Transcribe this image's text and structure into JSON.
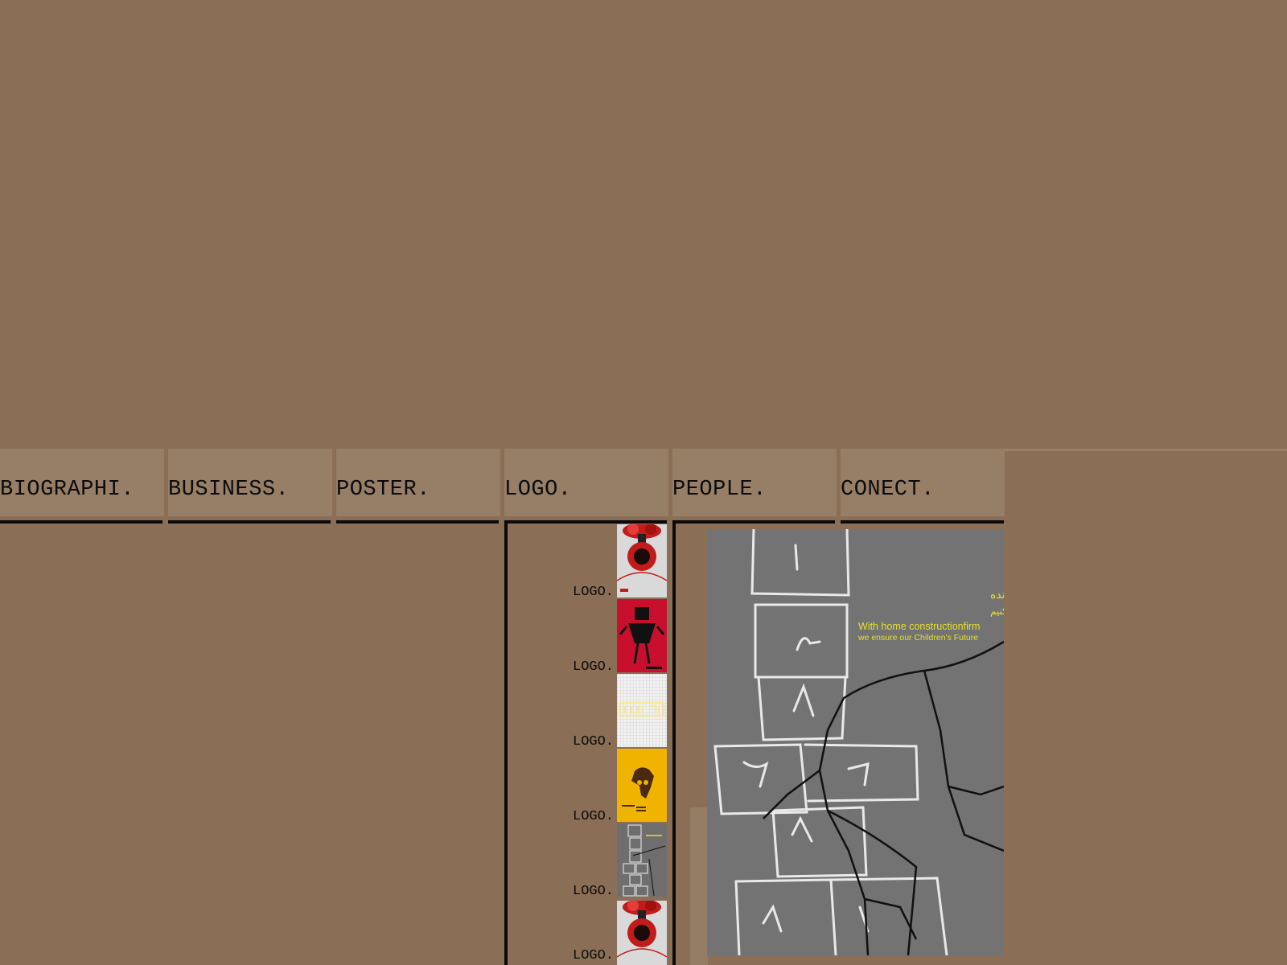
{
  "nav": {
    "tabs": [
      {
        "label": "BIOGRAPHI."
      },
      {
        "label": "BUSINESS."
      },
      {
        "label": "POSTER."
      },
      {
        "label": "LOGO."
      },
      {
        "label": "PEOPLE."
      },
      {
        "label": "CONECT."
      }
    ]
  },
  "gallery": {
    "items": [
      {
        "label": "LOGO.",
        "icon": "mushroom-cloud-logo"
      },
      {
        "label": "LOGO.",
        "icon": "figure-on-red-logo"
      },
      {
        "label": "LOGO.",
        "icon": "calligraphy-grid-logo"
      },
      {
        "label": "LOGO.",
        "icon": "africa-skull-logo"
      },
      {
        "label": "LOGO.",
        "icon": "hopscotch-logo"
      },
      {
        "label": "LOGO.",
        "icon": "mushroom-cloud-logo"
      }
    ]
  },
  "poster": {
    "persian_line1": "با ساخت خانه محکم اینده",
    "persian_line2": "کودکان خودمان را تضمین کنیم",
    "english_line1": "With home constructionfirm",
    "english_line2": "we ensure our Children's Future"
  },
  "colors": {
    "background": "#8b6e56",
    "tab": "#977e67",
    "border": "#0a0a0a",
    "poster_text": "#e6e02a"
  }
}
